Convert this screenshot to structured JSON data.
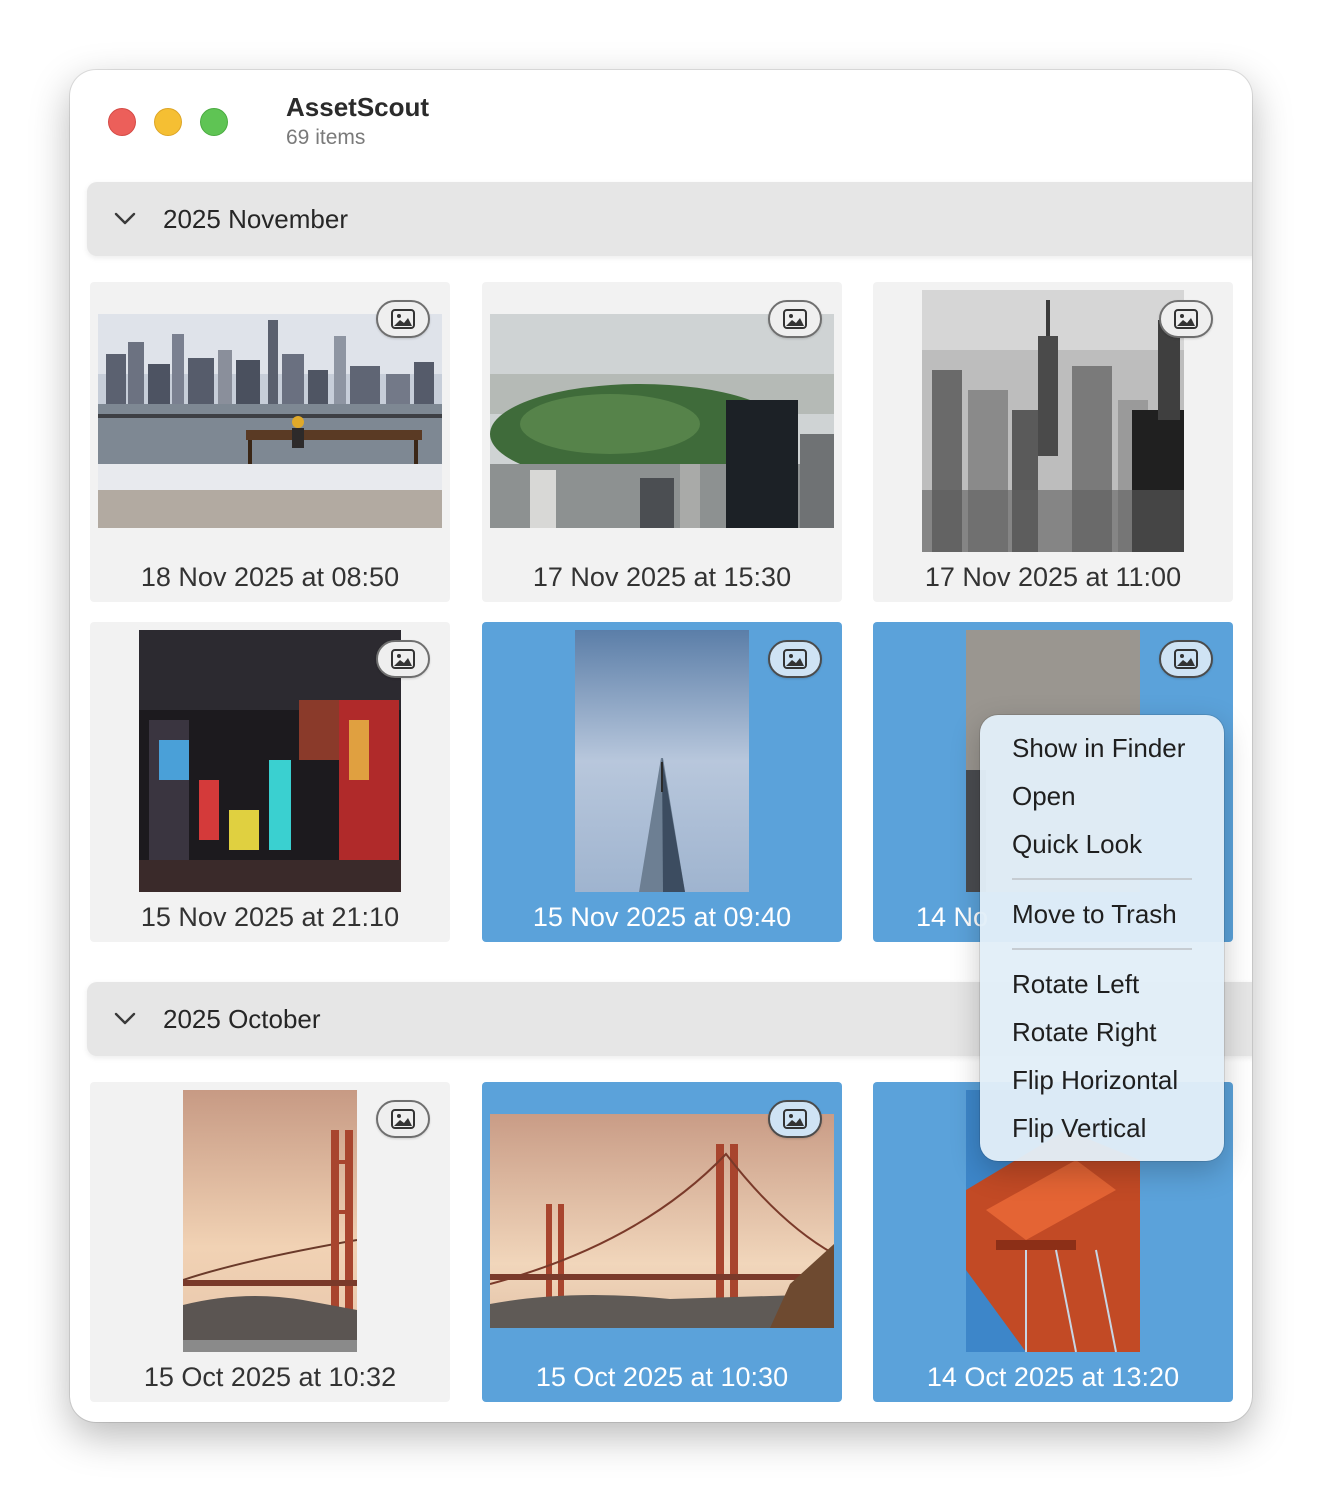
{
  "window": {
    "title": "AssetScout",
    "subtitle": "69 items"
  },
  "sections": [
    {
      "label": "2025 November",
      "items": [
        {
          "caption": "18 Nov 2025 at 08:50",
          "selected": false,
          "icon": "image-icon"
        },
        {
          "caption": "17 Nov 2025 at 15:30",
          "selected": false,
          "icon": "image-icon"
        },
        {
          "caption": "17 Nov 2025 at 11:00",
          "selected": false,
          "icon": "image-icon"
        },
        {
          "caption": "15 Nov 2025 at 21:10",
          "selected": false,
          "icon": "image-icon"
        },
        {
          "caption": "15 Nov 2025 at 09:40",
          "selected": true,
          "icon": "image-icon"
        },
        {
          "caption": "14 Nov 2025 at 13:20",
          "visible_caption": "14 No",
          "selected": true,
          "icon": "image-icon"
        }
      ]
    },
    {
      "label": "2025 October",
      "items": [
        {
          "caption": "15 Oct 2025 at 10:32",
          "selected": false,
          "icon": "image-icon"
        },
        {
          "caption": "15 Oct 2025 at 10:30",
          "selected": true,
          "icon": "image-icon"
        },
        {
          "caption": "14 Oct 2025 at 13:20",
          "selected": true,
          "icon": "image-icon"
        }
      ]
    }
  ],
  "context_menu": {
    "groups": [
      [
        "Show in Finder",
        "Open",
        "Quick Look"
      ],
      [
        "Move to Trash"
      ],
      [
        "Rotate Left",
        "Rotate Right",
        "Flip Horizontal",
        "Flip Vertical"
      ]
    ]
  },
  "colors": {
    "selection": "#5ba2da",
    "card": "#f2f2f2",
    "section_header": "#e6e6e6",
    "traffic_red": "#ec5f5a",
    "traffic_yellow": "#f5bf33",
    "traffic_green": "#5fc454"
  }
}
